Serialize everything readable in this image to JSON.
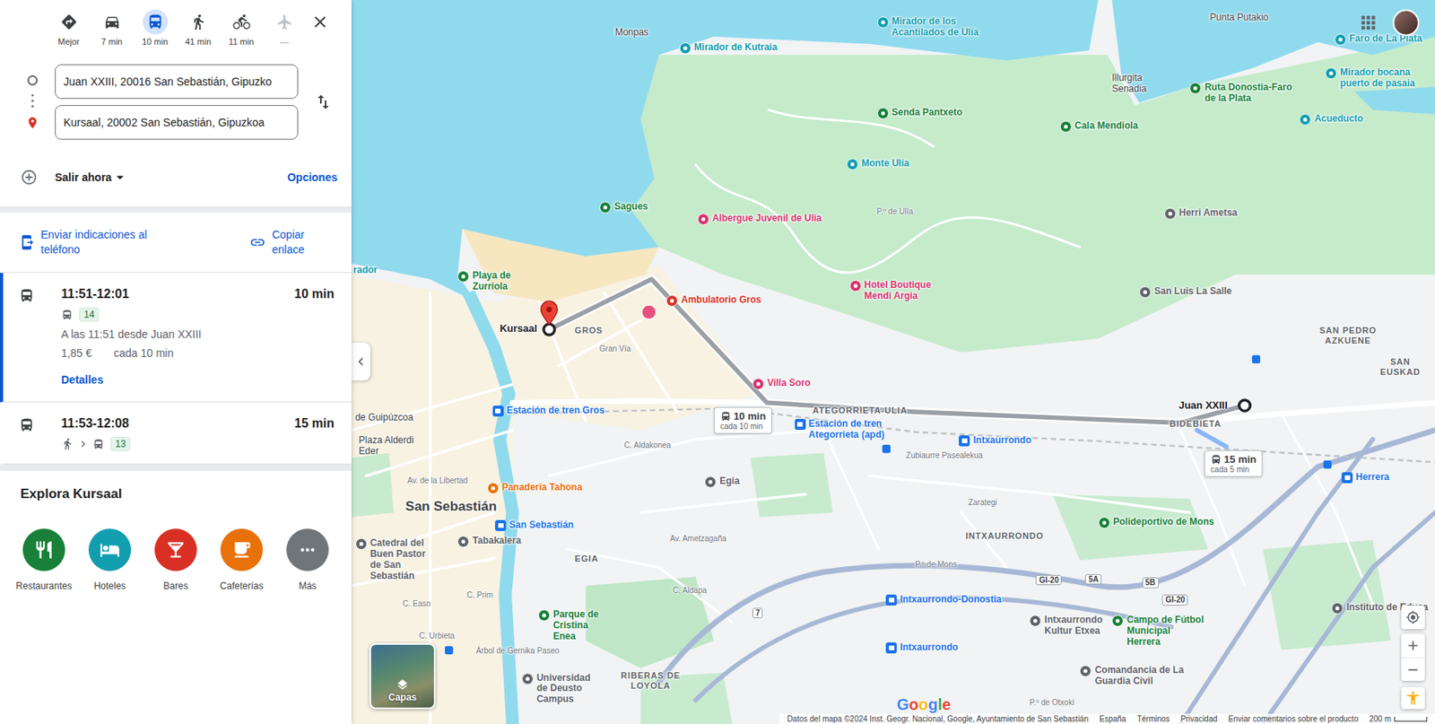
{
  "directions": {
    "modes": [
      {
        "label": "Mejor",
        "kind": "best",
        "selected": false,
        "disabled": false
      },
      {
        "label": "7 min",
        "kind": "car",
        "selected": false,
        "disabled": false
      },
      {
        "label": "10 min",
        "kind": "transit",
        "selected": true,
        "disabled": false
      },
      {
        "label": "41 min",
        "kind": "walk",
        "selected": false,
        "disabled": false
      },
      {
        "label": "11 min",
        "kind": "bike",
        "selected": false,
        "disabled": false
      },
      {
        "label": "—",
        "kind": "plane",
        "selected": false,
        "disabled": true
      }
    ],
    "origin": "Juan XXIII, 20016 San Sebastián, Gipuzko",
    "destination": "Kursaal, 20002 San Sebastián, Gipuzkoa",
    "departure": "Salir ahora",
    "options": "Opciones",
    "share": {
      "send": "Enviar indicaciones al teléfono",
      "copy": "Copiar enlace"
    },
    "routes": [
      {
        "time": "11:51-12:01",
        "duration": "10 min",
        "selected": true,
        "walk_first": false,
        "line": "14",
        "departure": "A las 11:51 desde Juan XXIII",
        "price": "1,85 €",
        "frequency": "cada 10 min",
        "details": "Detalles"
      },
      {
        "time": "11:53-12:08",
        "duration": "15 min",
        "selected": false,
        "walk_first": true,
        "line": "13"
      }
    ]
  },
  "explore": {
    "title": "Explora Kursaal",
    "categories": [
      {
        "label": "Restaurantes",
        "kind": "restaurants",
        "color": "#188038"
      },
      {
        "label": "Hoteles",
        "kind": "hotels",
        "color": "#129eaf"
      },
      {
        "label": "Bares",
        "kind": "bars",
        "color": "#d93025"
      },
      {
        "label": "Cafeterías",
        "kind": "cafes",
        "color": "#e8710a"
      },
      {
        "label": "Más",
        "kind": "more",
        "color": "#70757a"
      }
    ]
  },
  "map": {
    "labels": [
      {
        "text": "Monpas",
        "kind": "place"
      },
      {
        "text": "Mirador de Kutraia",
        "kind": "poi",
        "color": "#129eaf"
      },
      {
        "text": "Mirador de los Acantilados de Ulía",
        "kind": "poi",
        "color": "#129eaf"
      },
      {
        "text": "Punta Putakio",
        "kind": "place"
      },
      {
        "text": "Faro de La Plata",
        "kind": "poi",
        "color": "#129eaf"
      },
      {
        "text": "Mirador bocana puerto de pasaia",
        "kind": "poi",
        "color": "#129eaf"
      },
      {
        "text": "Illurgita Senadia",
        "kind": "place"
      },
      {
        "text": "Ruta Donostia-Faro de la Plata",
        "kind": "poi",
        "color": "#188038"
      },
      {
        "text": "Senda Pantxeto",
        "kind": "poi",
        "color": "#188038"
      },
      {
        "text": "Cala Mendiola",
        "kind": "poi",
        "color": "#188038"
      },
      {
        "text": "Acueducto",
        "kind": "poi",
        "color": "#129eaf"
      },
      {
        "text": "Monte Ulía",
        "kind": "poi",
        "color": "#129eaf"
      },
      {
        "text": "Sagues",
        "kind": "poi",
        "color": "#188038"
      },
      {
        "text": "Albergue Juvenil de Ulía",
        "kind": "poi",
        "color": "#d6336c"
      },
      {
        "text": "P.º de Ulía",
        "kind": "road"
      },
      {
        "text": "Herri Ametsa",
        "kind": "poi",
        "color": "#5f6368"
      },
      {
        "text": "Playa de Zurriola",
        "kind": "poi",
        "color": "#188038"
      },
      {
        "text": "Ambulatorio Gros",
        "kind": "poi",
        "color": "#d93025"
      },
      {
        "text": "Hotel Boutique Mendi Argia",
        "kind": "poi",
        "color": "#d6336c"
      },
      {
        "text": "San Luis La Salle",
        "kind": "poi",
        "color": "#5f6368"
      },
      {
        "text": "Kursaal",
        "kind": "endpoint"
      },
      {
        "text": "GROS",
        "kind": "district"
      },
      {
        "text": "SAN PEDRO AZKUENE",
        "kind": "district"
      },
      {
        "text": "SAN EUSKAD",
        "kind": "district"
      },
      {
        "text": "Gran Vía",
        "kind": "road"
      },
      {
        "text": "Villa Soro",
        "kind": "poi",
        "color": "#d6336c"
      },
      {
        "text": "ATEGORRIETA-ULIA",
        "kind": "district"
      },
      {
        "text": "Juan XXIII",
        "kind": "endpoint"
      },
      {
        "text": "BIDEBIETA",
        "kind": "district"
      },
      {
        "text": "Estación de tren Gros",
        "kind": "station"
      },
      {
        "text": "Estación de tren Ategorrieta (apd)",
        "kind": "station"
      },
      {
        "text": "Intxaurrondo",
        "kind": "station"
      },
      {
        "text": "Zubiaurre Pasealekua",
        "kind": "road"
      },
      {
        "text": "de Guipúzcoa",
        "kind": "place"
      },
      {
        "text": "Plaza Alderdi Eder",
        "kind": "place"
      },
      {
        "text": "C. Aldakonea",
        "kind": "road"
      },
      {
        "text": "Av. de la Libertad",
        "kind": "road"
      },
      {
        "text": "Panadería Tahona",
        "kind": "poi",
        "color": "#e8710a"
      },
      {
        "text": "San Sebastián",
        "kind": "city"
      },
      {
        "text": "Egia",
        "kind": "poi",
        "color": "#5f6368"
      },
      {
        "text": "Zarategi",
        "kind": "road"
      },
      {
        "text": "Polideportivo de Mons",
        "kind": "poi",
        "color": "#188038"
      },
      {
        "text": "INTXAURRONDO",
        "kind": "district"
      },
      {
        "text": "Herrera",
        "kind": "station"
      },
      {
        "text": "San Sebastián",
        "kind": "station"
      },
      {
        "text": "Tabakalera",
        "kind": "poi",
        "color": "#5f6368"
      },
      {
        "text": "Catedral del Buen Pastor de San Sebastián",
        "kind": "poi",
        "color": "#5f6368"
      },
      {
        "text": "Av. Ametzagaña",
        "kind": "road"
      },
      {
        "text": "EGIA",
        "kind": "district"
      },
      {
        "text": "P.º de Mons",
        "kind": "road"
      },
      {
        "text": "C. Aldapa",
        "kind": "road"
      },
      {
        "text": "Parque de Cristina Enea",
        "kind": "poi",
        "color": "#188038"
      },
      {
        "text": "Intxaurrondo-Donostia",
        "kind": "station"
      },
      {
        "text": "Intxaurrondo Kultur Etxea",
        "kind": "poi",
        "color": "#5f6368"
      },
      {
        "text": "Campo de Fútbol Municipal Herrera",
        "kind": "poi",
        "color": "#188038"
      },
      {
        "text": "Instituto de Educa",
        "kind": "poi",
        "color": "#5f6368"
      },
      {
        "text": "Intxaurrondo",
        "kind": "station"
      },
      {
        "text": "Comandancia de La Guardia Civil",
        "kind": "poi",
        "color": "#5f6368"
      },
      {
        "text": "RIBERAS DE LOYOLA",
        "kind": "district"
      },
      {
        "text": "Universidad de Deusto Campus",
        "kind": "poi",
        "color": "#5f6368"
      },
      {
        "text": "P.º de Otxoki",
        "kind": "road"
      },
      {
        "text": "GI-20",
        "kind": "shield"
      },
      {
        "text": "5A",
        "kind": "shield"
      },
      {
        "text": "5B",
        "kind": "shield"
      },
      {
        "text": "GI-20",
        "kind": "shield"
      },
      {
        "text": "7",
        "kind": "shield"
      },
      {
        "text": "rador",
        "kind": "fragment",
        "color": "#129eaf"
      },
      {
        "text": "C. Easo",
        "kind": "road"
      },
      {
        "text": "C. Urbieta",
        "kind": "road"
      },
      {
        "text": "C. Prim",
        "kind": "road"
      },
      {
        "text": "Árbol de Gernika Paseo",
        "kind": "road"
      }
    ],
    "callouts": [
      {
        "duration": "10 min",
        "frequency": "cada 10 min"
      },
      {
        "duration": "15 min",
        "frequency": "cada 5 min"
      }
    ],
    "logo": "Google",
    "layers": "Capas",
    "footer": {
      "attribution": "Datos del mapa ©2024 Inst. Geogr. Nacional, Google, Ayuntamiento de San Sebastián",
      "links": [
        "España",
        "Términos",
        "Privacidad",
        "Enviar comentarios sobre el producto"
      ],
      "scale": "200 m"
    }
  }
}
